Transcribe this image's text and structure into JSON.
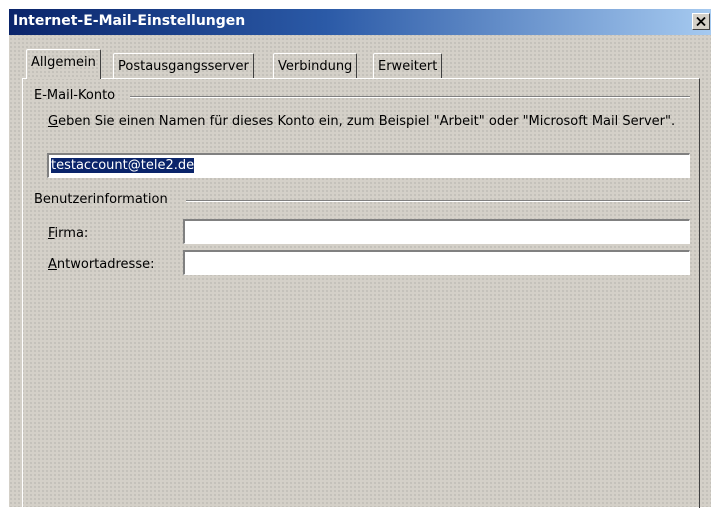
{
  "window": {
    "title": "Internet-E-Mail-Einstellungen"
  },
  "tabs": [
    {
      "label": "Allgemein",
      "active": true
    },
    {
      "label": "Postausgangsserver",
      "active": false
    },
    {
      "label": "Verbindung",
      "active": false
    },
    {
      "label": "Erweitert",
      "active": false
    }
  ],
  "email_account": {
    "group_label": "E-Mail-Konto",
    "description_accesskey": "G",
    "description_rest": "eben Sie einen Namen für dieses Konto ein, zum Beispiel \"Arbeit\" oder \"Microsoft Mail Server\".",
    "account_name_value": "testaccount@tele2.de"
  },
  "user_info": {
    "group_label": "Benutzerinformation",
    "firma_accesskey": "F",
    "firma_rest": "irma:",
    "firma_value": "",
    "reply_accesskey": "A",
    "reply_rest": "ntwortadresse:",
    "reply_value": ""
  },
  "icons": {
    "close": "close-icon"
  },
  "colors": {
    "titlebar_start": "#0a246a",
    "titlebar_end": "#a6caf0",
    "dialog_face": "#d4d0c8",
    "selection": "#0a246a"
  }
}
